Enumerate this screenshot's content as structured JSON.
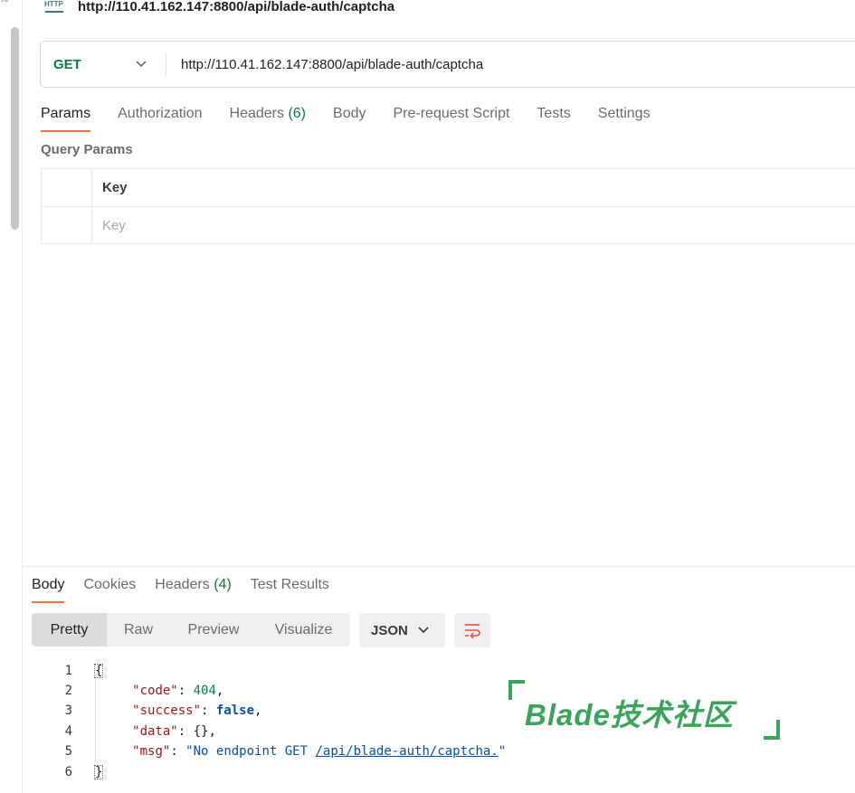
{
  "gutter": {
    "fragment": "%"
  },
  "request": {
    "title": "http://110.41.162.147:8800/api/blade-auth/captcha",
    "method": "GET",
    "url": "http://110.41.162.147:8800/api/blade-auth/captcha",
    "tabs": [
      {
        "label": "Params",
        "active": true
      },
      {
        "label": "Authorization"
      },
      {
        "label": "Headers",
        "count": "(6)"
      },
      {
        "label": "Body"
      },
      {
        "label": "Pre-request Script"
      },
      {
        "label": "Tests"
      },
      {
        "label": "Settings"
      }
    ],
    "section_label": "Query Params",
    "params_table": {
      "key_header": "Key",
      "key_placeholder": "Key"
    }
  },
  "response": {
    "tabs": [
      {
        "label": "Body",
        "active": true
      },
      {
        "label": "Cookies"
      },
      {
        "label": "Headers",
        "count": "(4)"
      },
      {
        "label": "Test Results"
      }
    ],
    "views": [
      "Pretty",
      "Raw",
      "Preview",
      "Visualize"
    ],
    "active_view": "Pretty",
    "format": "JSON",
    "line_numbers": [
      "1",
      "2",
      "3",
      "4",
      "5",
      "6"
    ],
    "body": {
      "open": "{",
      "close": "}",
      "code_key": "\"code\"",
      "code_val": "404",
      "success_key": "\"success\"",
      "success_val": "false",
      "data_key": "\"data\"",
      "data_val": "{}",
      "msg_key": "\"msg\"",
      "msg_prefix": "\"No endpoint GET ",
      "msg_link": "/api/blade-auth/captcha.",
      "msg_suffix": "\""
    }
  },
  "watermark": {
    "text": "Blade技术社区"
  },
  "colors": {
    "accent": "#ff6c37",
    "method_get": "#0f7b3f",
    "watermark": "#3ca35a"
  },
  "icons": [
    "http-icon",
    "chevron-down-icon",
    "wrap-lines-icon"
  ]
}
